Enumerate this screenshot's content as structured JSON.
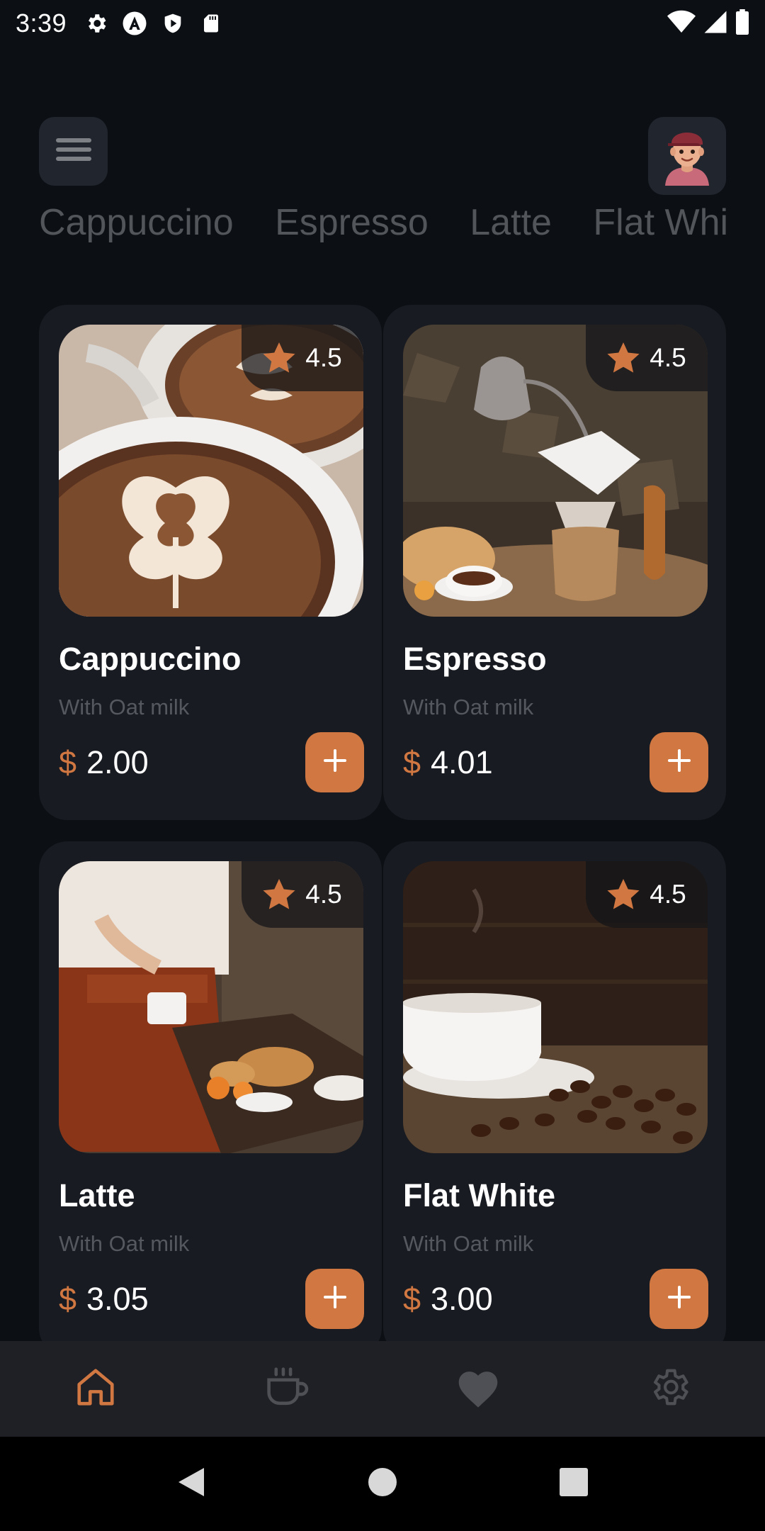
{
  "status_bar": {
    "time": "3:39",
    "left_icons": [
      "gear-icon",
      "a-circle-icon",
      "shield-play-icon",
      "sd-card-icon"
    ],
    "right_icons": [
      "wifi-icon",
      "signal-icon",
      "battery-icon"
    ]
  },
  "header": {
    "menu_icon": "hamburger-menu-icon",
    "avatar_icon": "user-avatar"
  },
  "categories": [
    "Cappuccino",
    "Espresso",
    "Latte",
    "Flat White"
  ],
  "products": [
    {
      "name": "Cappuccino",
      "subtitle": "With Oat milk",
      "currency": "$",
      "price": "2.00",
      "rating": "4.5"
    },
    {
      "name": "Espresso",
      "subtitle": "With Oat milk",
      "currency": "$",
      "price": "4.01",
      "rating": "4.5"
    },
    {
      "name": "Latte",
      "subtitle": "With Oat milk",
      "currency": "$",
      "price": "3.05",
      "rating": "4.5"
    },
    {
      "name": "Flat White",
      "subtitle": "With Oat milk",
      "currency": "$",
      "price": "3.00",
      "rating": "4.5"
    }
  ],
  "bottom_nav": [
    {
      "icon": "home-icon",
      "active": true
    },
    {
      "icon": "coffee-cup-icon",
      "active": false
    },
    {
      "icon": "heart-icon",
      "active": false
    },
    {
      "icon": "settings-icon",
      "active": false
    }
  ],
  "colors": {
    "background": "#0c0f14",
    "card": "#181b21",
    "accent": "#d17842",
    "muted_text": "#55595f",
    "nav_bar": "#1e2026"
  }
}
